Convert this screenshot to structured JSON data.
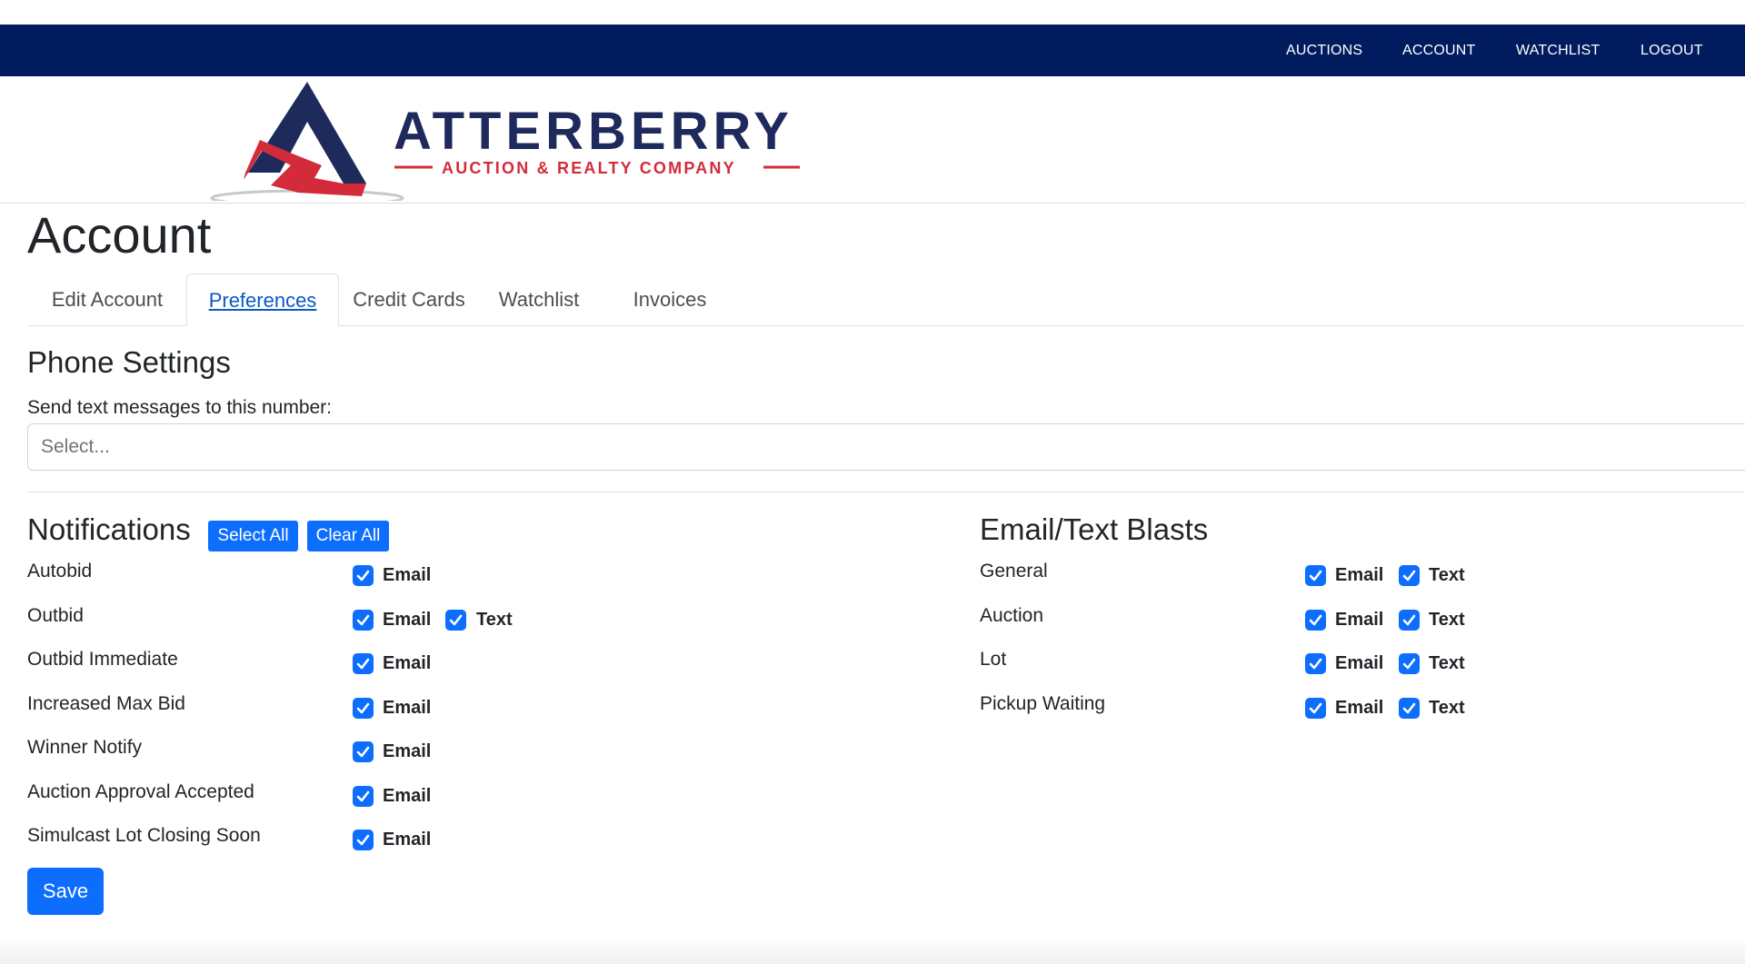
{
  "topnav": {
    "auctions": "AUCTIONS",
    "account": "ACCOUNT",
    "watchlist": "WATCHLIST",
    "logout": "LOGOUT"
  },
  "logo": {
    "name": "ATTERBERRY",
    "tagline": "AUCTION & REALTY COMPANY"
  },
  "page": {
    "title": "Account"
  },
  "tabs": [
    {
      "label": "Edit Account"
    },
    {
      "label": "Preferences"
    },
    {
      "label": "Credit Cards"
    },
    {
      "label": "Watchlist"
    },
    {
      "label": "Invoices"
    }
  ],
  "phone_settings": {
    "title": "Phone Settings",
    "label": "Send text messages to this number:",
    "select_placeholder": "Select..."
  },
  "notifications": {
    "title": "Notifications",
    "select_all": "Select All",
    "clear_all": "Clear All",
    "rows": [
      {
        "label": "Autobid",
        "email": "Email",
        "text": ""
      },
      {
        "label": "Outbid",
        "email": "Email",
        "text": "Text"
      },
      {
        "label": "Outbid Immediate",
        "email": "Email",
        "text": ""
      },
      {
        "label": "Increased Max Bid",
        "email": "Email",
        "text": ""
      },
      {
        "label": "Winner Notify",
        "email": "Email",
        "text": ""
      },
      {
        "label": "Auction Approval Accepted",
        "email": "Email",
        "text": ""
      },
      {
        "label": "Simulcast Lot Closing Soon",
        "email": "Email",
        "text": ""
      }
    ]
  },
  "blasts": {
    "title": "Email/Text Blasts",
    "rows": [
      {
        "label": "General",
        "email": "Email",
        "text": "Text"
      },
      {
        "label": "Auction",
        "email": "Email",
        "text": "Text"
      },
      {
        "label": "Lot",
        "email": "Email",
        "text": "Text"
      },
      {
        "label": "Pickup Waiting",
        "email": "Email",
        "text": "Text"
      }
    ]
  },
  "save_label": "Save",
  "colors": {
    "nav_bg": "#001c5e",
    "primary": "#0d6efd",
    "logo_navy": "#1f2a5c",
    "logo_red": "#d42b3a"
  },
  "icons": [
    "check-icon"
  ]
}
